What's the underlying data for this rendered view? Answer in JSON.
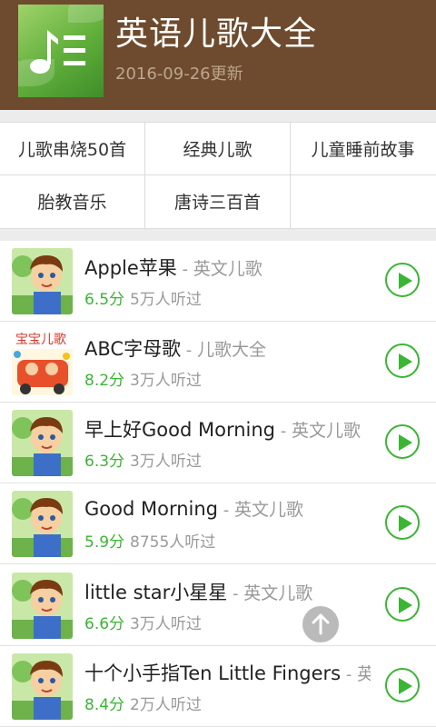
{
  "header": {
    "title": "英语儿歌大全",
    "updated": "2016-09-26更新",
    "icon": "music-note-icon"
  },
  "categories": [
    "儿歌串烧50首",
    "经典儿歌",
    "儿童睡前故事",
    "胎教音乐",
    "唐诗三百首"
  ],
  "songs": [
    {
      "title": "Apple苹果",
      "sep": " - ",
      "category": "英文儿歌",
      "score": "6.5分",
      "plays": "5万人听过",
      "thumb": "boy"
    },
    {
      "title": "ABC字母歌",
      "sep": " - ",
      "category": "儿歌大全",
      "score": "8.2分",
      "plays": "3万人听过",
      "thumb": "kids"
    },
    {
      "title": "早上好Good Morning",
      "sep": " - ",
      "category": "英文儿歌",
      "score": "6.3分",
      "plays": "3万人听过",
      "thumb": "boy"
    },
    {
      "title": "Good Morning",
      "sep": " - ",
      "category": "英文儿歌",
      "score": "5.9分",
      "plays": "8755人听过",
      "thumb": "boy"
    },
    {
      "title": "little star小星星",
      "sep": " - ",
      "category": "英文儿歌",
      "score": "6.6分",
      "plays": "3万人听过",
      "thumb": "boy"
    },
    {
      "title": "十个小手指Ten Little Fingers",
      "sep": " - ",
      "category": "英",
      "score": "8.4分",
      "plays": "2万人听过",
      "thumb": "boy"
    }
  ],
  "colors": {
    "header_bg": "#6e4b2e",
    "accent_green": "#3ab534"
  }
}
